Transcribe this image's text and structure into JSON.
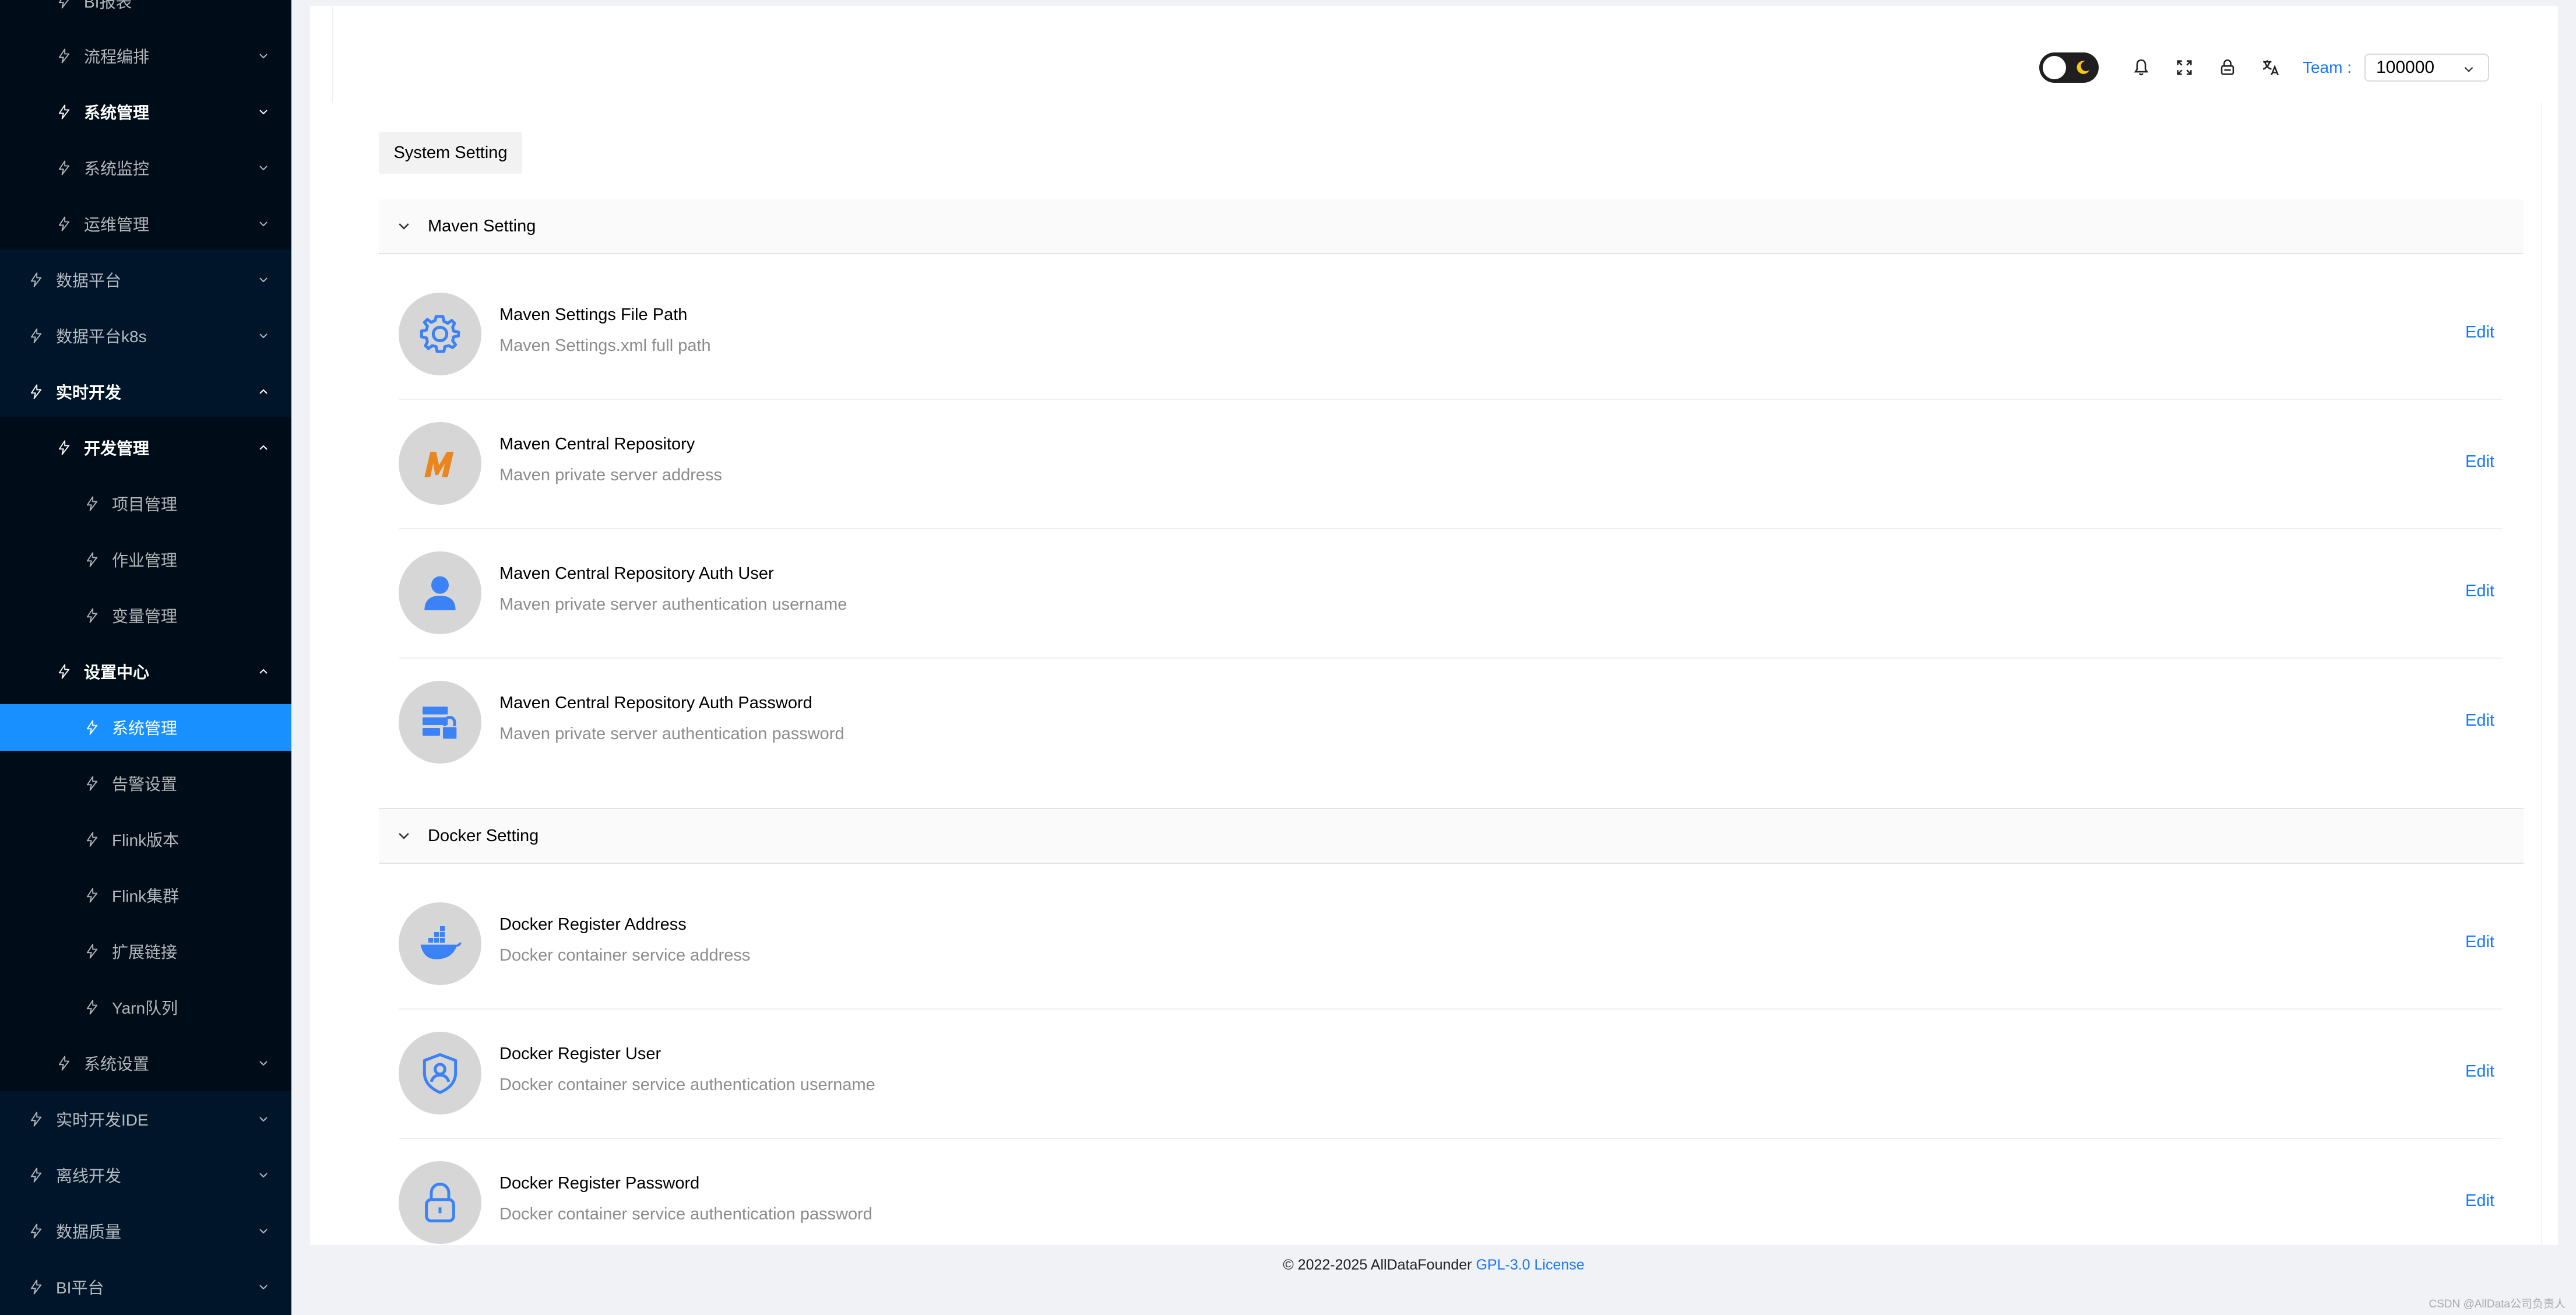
{
  "sidebar": {
    "items": [
      {
        "label": "BI报表"
      },
      {
        "label": "流程编排"
      },
      {
        "label": "系统管理"
      },
      {
        "label": "系统监控"
      },
      {
        "label": "运维管理"
      },
      {
        "label": "数据平台"
      },
      {
        "label": "数据平台k8s"
      },
      {
        "label": "实时开发"
      },
      {
        "label": "开发管理"
      },
      {
        "label": "项目管理"
      },
      {
        "label": "作业管理"
      },
      {
        "label": "变量管理"
      },
      {
        "label": "设置中心"
      },
      {
        "label": "系统管理"
      },
      {
        "label": "告警设置"
      },
      {
        "label": "Flink版本"
      },
      {
        "label": "Flink集群"
      },
      {
        "label": "扩展链接"
      },
      {
        "label": "Yarn队列"
      },
      {
        "label": "系统设置"
      },
      {
        "label": "实时开发IDE"
      },
      {
        "label": "离线开发"
      },
      {
        "label": "数据质量"
      },
      {
        "label": "BI平台"
      }
    ]
  },
  "header": {
    "team_label": "Team :",
    "team_value": "100000"
  },
  "tab": {
    "label": "System Setting"
  },
  "sections": [
    {
      "title": "Maven Setting",
      "rows": [
        {
          "title": "Maven Settings File Path",
          "desc": "Maven Settings.xml full path",
          "action": "Edit",
          "icon": "gear-icon"
        },
        {
          "title": "Maven Central Repository",
          "desc": "Maven private server address",
          "action": "Edit",
          "icon": "maven-logo-icon"
        },
        {
          "title": "Maven Central Repository Auth User",
          "desc": "Maven private server authentication username",
          "action": "Edit",
          "icon": "user-icon"
        },
        {
          "title": "Maven Central Repository Auth Password",
          "desc": "Maven private server authentication password",
          "action": "Edit",
          "icon": "server-lock-icon"
        }
      ]
    },
    {
      "title": "Docker Setting",
      "rows": [
        {
          "title": "Docker Register Address",
          "desc": "Docker container service address",
          "action": "Edit",
          "icon": "docker-icon"
        },
        {
          "title": "Docker Register User",
          "desc": "Docker container service authentication username",
          "action": "Edit",
          "icon": "shield-user-icon"
        },
        {
          "title": "Docker Register Password",
          "desc": "Docker container service authentication password",
          "action": "Edit",
          "icon": "lock-icon"
        }
      ]
    }
  ],
  "footer": {
    "copyright": "© 2022-2025 AllDataFounder",
    "license": "GPL-3.0 License"
  },
  "watermark": "CSDN @AllData公司负责人",
  "colors": {
    "sidebar": "#001529",
    "submenu": "#000c17",
    "active": "#1890ff",
    "link": "#1677ff"
  }
}
